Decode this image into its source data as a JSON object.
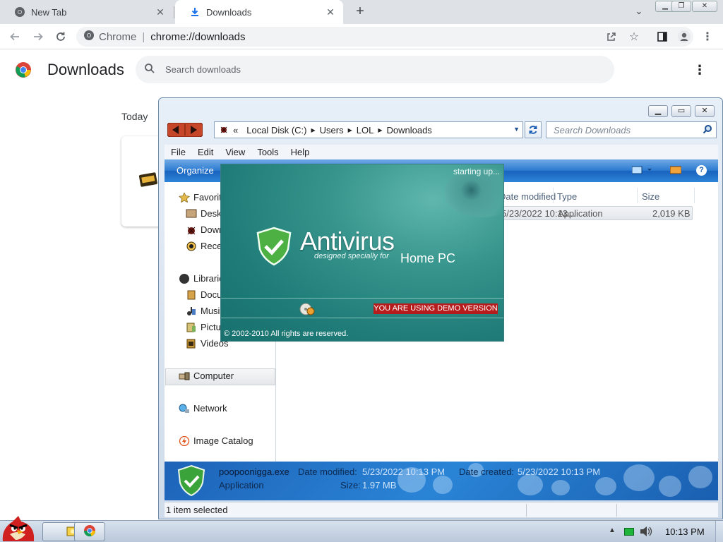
{
  "browser": {
    "tabs": [
      {
        "label": "New Tab",
        "icon": "chrome-icon"
      },
      {
        "label": "Downloads",
        "icon": "download-icon"
      }
    ],
    "new_tab_label": "+",
    "omnibox": {
      "site_label": "Chrome",
      "url": "chrome://downloads"
    }
  },
  "downloads_page": {
    "title": "Downloads",
    "search_placeholder": "Search downloads",
    "date_group": "Today"
  },
  "explorer": {
    "breadcrumb": [
      "Local Disk (C:)",
      "Users",
      "LOL",
      "Downloads"
    ],
    "breadcrumb_prefix": "«",
    "search_placeholder": "Search Downloads",
    "menu": [
      "File",
      "Edit",
      "View",
      "Tools",
      "Help"
    ],
    "organize_label": "Organize",
    "nav": {
      "favorites": "Favorites",
      "desktop": "Desktop",
      "downloads": "Downloads",
      "recent": "Recent Places",
      "libraries": "Libraries",
      "documents": "Documents",
      "music": "Music",
      "pictures": "Pictures",
      "videos": "Videos",
      "computer": "Computer",
      "network": "Network",
      "image_catalog": "Image Catalog"
    },
    "columns": {
      "modified": "Date modified",
      "type": "Type",
      "size": "Size"
    },
    "file": {
      "modified": "5/23/2022 10:13...",
      "type": "Application",
      "size": "2,019 KB"
    },
    "details": {
      "name": "poopoonigga.exe",
      "modified_label": "Date modified:",
      "modified_value": "5/23/2022 10:13 PM",
      "created_label": "Date created:",
      "created_value": "5/23/2022 10:13 PM",
      "type": "Application",
      "size_label": "Size:",
      "size_value": "1.97 MB"
    },
    "status": "1 item selected"
  },
  "splash": {
    "status": "starting up...",
    "title": "Antivirus",
    "subtitle": "designed specially for",
    "subtitle_big": "Home PC",
    "demo": "YOU ARE USING DEMO VERSION",
    "copyright": "© 2002-2010 All rights are reserved."
  },
  "taskbar": {
    "clock": "10:13 PM"
  },
  "colors": {
    "command_bar": "#2e7bd2",
    "splash_bg": "#36948c",
    "demo_banner": "#b71c1c",
    "tray_green": "#1fb53a"
  }
}
